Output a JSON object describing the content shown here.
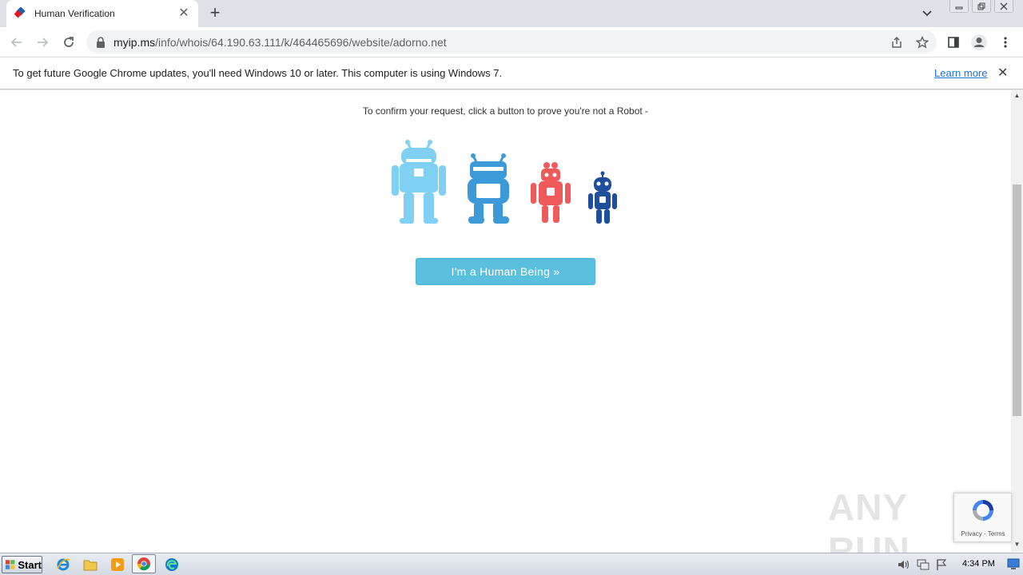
{
  "browser": {
    "tab": {
      "title": "Human Verification",
      "close": "✕"
    },
    "new_tab": "+",
    "url": {
      "host": "myip.ms",
      "path": "/info/whois/64.190.63.111/k/464465696/website/adorno.net"
    }
  },
  "infobar": {
    "message": "To get future Google Chrome updates, you'll need Windows 10 or later. This computer is using Windows 7.",
    "link": "Learn more",
    "close": "✕"
  },
  "page": {
    "confirm_text": "To confirm your request, click a button to prove you're not a Robot -",
    "button_label": "I'm a Human Being »",
    "robot_colors": [
      "#7fd0f2",
      "#3d9ad9",
      "#ef5b5b",
      "#1f4e9c"
    ]
  },
  "watermark": {
    "text": "ANY RUN"
  },
  "recaptcha": {
    "links": "Privacy - Terms"
  },
  "taskbar": {
    "start": "Start",
    "clock": "4:34 PM"
  }
}
